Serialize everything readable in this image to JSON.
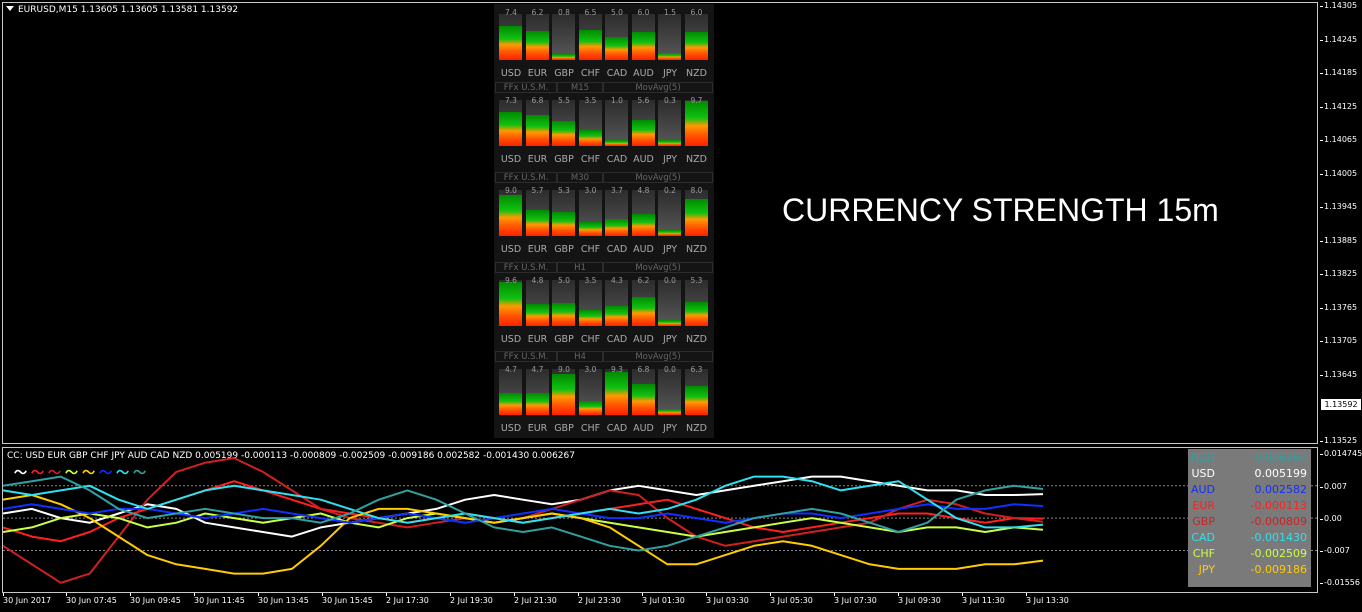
{
  "main_title": "EURUSD,M15  1.13605 1.13605 1.13581 1.13592",
  "big_label": "CURRENCY STRENGTH 15m",
  "current_price": "1.13592",
  "y_ticks": [
    "1.14305",
    "1.14245",
    "1.14185",
    "1.14125",
    "1.14065",
    "1.14005",
    "1.13945",
    "1.13885",
    "1.13825",
    "1.13765",
    "1.13705",
    "1.13645",
    "1.13525"
  ],
  "sub_ticks": [
    "0.014745",
    "0.007",
    "0.00",
    "-0.007",
    "-0.01556"
  ],
  "x_ticks": [
    "30 Jun 2017",
    "30 Jun 07:45",
    "30 Jun 09:45",
    "30 Jun 11:45",
    "30 Jun 13:45",
    "30 Jun 15:45",
    "2 Jul 17:30",
    "2 Jul 19:30",
    "2 Jul 21:30",
    "2 Jul 23:30",
    "3 Jul 01:30",
    "3 Jul 03:30",
    "3 Jul 05:30",
    "3 Jul 07:30",
    "3 Jul 09:30",
    "3 Jul 11:30",
    "3 Jul 13:30"
  ],
  "currencies": [
    "USD",
    "EUR",
    "GBP",
    "CHF",
    "CAD",
    "AUD",
    "JPY",
    "NZD"
  ],
  "panel": {
    "blocks": [
      {
        "header": null,
        "values": [
          "7.4",
          "6.2",
          "0.8",
          "6.5",
          "5.0",
          "6.0",
          "1.5",
          "6.0"
        ]
      },
      {
        "header": {
          "name": "FFx U.S.M.",
          "tf": "M15",
          "method": "MovAvg(5)"
        },
        "values": [
          "7.3",
          "6.8",
          "5.5",
          "3.5",
          "1.0",
          "5.6",
          "0.3",
          "9.7"
        ]
      },
      {
        "header": {
          "name": "FFx U.S.M.",
          "tf": "M30",
          "method": "MovAvg(5)"
        },
        "values": [
          "9.0",
          "5.7",
          "5.3",
          "3.0",
          "3.7",
          "4.8",
          "0.2",
          "8.0"
        ]
      },
      {
        "header": {
          "name": "FFx U.S.M.",
          "tf": "H1",
          "method": "MovAvg(5)"
        },
        "values": [
          "9.6",
          "4.8",
          "5.0",
          "3.5",
          "4.3",
          "6.2",
          "0.0",
          "5.3"
        ]
      },
      {
        "header": {
          "name": "FFx U.S.M.",
          "tf": "H4",
          "method": "MovAvg(5)"
        },
        "values": [
          "4.7",
          "4.7",
          "9.0",
          "3.0",
          "9.3",
          "6.8",
          "0.0",
          "6.3"
        ]
      }
    ]
  },
  "cc": {
    "title": "CC:  USD EUR GBP CHF JPY AUD CAD NZD 0.005199 -0.000113 -0.000809 -0.002509 -0.009186 0.002582 -0.001430 0.006267",
    "legend_colors": [
      "#ffffff",
      "#ff2020",
      "#d02020",
      "#ccff44",
      "#ffcc00",
      "#1030ff",
      "#30e0f0",
      "#30a0a0"
    ],
    "legend_glyph": "〜",
    "table": [
      {
        "code": "NZD",
        "value": "0.006267",
        "color": "#30a0a0"
      },
      {
        "code": "USD",
        "value": "0.005199",
        "color": "#ffffff"
      },
      {
        "code": "AUD",
        "value": "0.002582",
        "color": "#1030ff"
      },
      {
        "code": "EUR",
        "value": "-0.000113",
        "color": "#ff2020"
      },
      {
        "code": "GBP",
        "value": "-0.000809",
        "color": "#d02020"
      },
      {
        "code": "CAD",
        "value": "-0.001430",
        "color": "#30e0f0"
      },
      {
        "code": "CHF",
        "value": "-0.002509",
        "color": "#ccff44"
      },
      {
        "code": "JPY",
        "value": "-0.009186",
        "color": "#ffcc00"
      }
    ],
    "series": [
      {
        "code": "USD",
        "color": "#ffffff",
        "values": [
          0.001,
          0.002,
          0.0,
          -0.001,
          0.001,
          0.003,
          0.002,
          -0.001,
          -0.002,
          -0.003,
          -0.004,
          -0.002,
          -0.001,
          0.0,
          0.001,
          0.002,
          0.004,
          0.005,
          0.004,
          0.003,
          0.004,
          0.006,
          0.007,
          0.006,
          0.005,
          0.006,
          0.007,
          0.008,
          0.009,
          0.009,
          0.008,
          0.007,
          0.006,
          0.006,
          0.005,
          0.005,
          0.0052
        ]
      },
      {
        "code": "EUR",
        "color": "#ff2020",
        "values": [
          -0.002,
          -0.004,
          -0.005,
          -0.003,
          0.0,
          0.002,
          0.004,
          0.006,
          0.008,
          0.006,
          0.004,
          0.002,
          0.001,
          0.0,
          -0.001,
          0.0,
          0.001,
          0.0,
          -0.001,
          0.0,
          0.001,
          0.002,
          0.003,
          0.004,
          0.002,
          0.0,
          -0.002,
          -0.003,
          -0.002,
          -0.001,
          0.0,
          0.001,
          0.001,
          0.0,
          -0.001,
          0.0,
          -0.0001
        ]
      },
      {
        "code": "GBP",
        "color": "#d02020",
        "values": [
          -0.006,
          -0.01,
          -0.014,
          -0.012,
          -0.004,
          0.004,
          0.01,
          0.012,
          0.013,
          0.01,
          0.006,
          0.002,
          0.0,
          -0.001,
          -0.002,
          -0.001,
          0.0,
          -0.001,
          0.0,
          0.002,
          0.004,
          0.006,
          0.005,
          0.0,
          -0.004,
          -0.006,
          -0.005,
          -0.004,
          -0.003,
          -0.002,
          -0.001,
          0.002,
          0.004,
          0.003,
          0.001,
          0.0,
          -0.0008
        ]
      },
      {
        "code": "CHF",
        "color": "#ccff44",
        "values": [
          -0.003,
          -0.002,
          0.0,
          0.001,
          0.0,
          -0.002,
          -0.001,
          0.001,
          0.0,
          -0.001,
          0.0,
          0.001,
          -0.001,
          -0.002,
          0.0,
          0.001,
          0.0,
          -0.001,
          0.0,
          0.001,
          0.0,
          -0.001,
          -0.002,
          -0.003,
          -0.004,
          -0.003,
          -0.002,
          -0.001,
          0.0,
          -0.001,
          -0.002,
          -0.003,
          -0.002,
          -0.002,
          -0.003,
          -0.002,
          -0.0025
        ]
      },
      {
        "code": "JPY",
        "color": "#ffcc00",
        "values": [
          0.004,
          0.005,
          0.003,
          0.0,
          -0.004,
          -0.008,
          -0.01,
          -0.011,
          -0.012,
          -0.012,
          -0.011,
          -0.006,
          0.0,
          0.002,
          0.002,
          0.001,
          0.0,
          -0.001,
          0.0,
          0.001,
          0.0,
          -0.002,
          -0.006,
          -0.01,
          -0.01,
          -0.008,
          -0.006,
          -0.005,
          -0.006,
          -0.008,
          -0.01,
          -0.011,
          -0.011,
          -0.011,
          -0.01,
          -0.01,
          -0.0092
        ]
      },
      {
        "code": "AUD",
        "color": "#1030ff",
        "values": [
          0.002,
          0.003,
          0.002,
          0.001,
          0.002,
          0.002,
          0.001,
          0.0,
          0.001,
          0.002,
          0.001,
          0.0,
          -0.001,
          0.0,
          0.001,
          0.0,
          -0.001,
          0.0,
          0.001,
          0.002,
          0.001,
          0.0,
          0.0,
          0.001,
          0.0,
          -0.001,
          0.0,
          0.001,
          0.001,
          0.0,
          0.001,
          0.002,
          0.003,
          0.002,
          0.002,
          0.003,
          0.0026
        ]
      },
      {
        "code": "CAD",
        "color": "#30e0f0",
        "values": [
          0.006,
          0.005,
          0.006,
          0.007,
          0.004,
          0.002,
          0.004,
          0.006,
          0.007,
          0.006,
          0.005,
          0.004,
          0.002,
          0.0,
          -0.001,
          0.0,
          0.001,
          0.0,
          -0.001,
          0.0,
          0.001,
          0.002,
          0.001,
          0.002,
          0.004,
          0.007,
          0.009,
          0.009,
          0.008,
          0.006,
          0.007,
          0.008,
          0.004,
          0.0,
          -0.002,
          -0.002,
          -0.0014
        ]
      },
      {
        "code": "NZD",
        "color": "#30a0a0",
        "values": [
          0.007,
          0.008,
          0.009,
          0.006,
          0.002,
          0.0,
          0.001,
          0.002,
          0.001,
          0.0,
          0.0,
          -0.001,
          0.001,
          0.004,
          0.006,
          0.004,
          0.001,
          -0.002,
          -0.003,
          -0.002,
          -0.004,
          -0.006,
          -0.007,
          -0.006,
          -0.004,
          -0.002,
          0.0,
          0.001,
          0.002,
          0.001,
          -0.001,
          -0.003,
          -0.001,
          0.004,
          0.006,
          0.007,
          0.0063
        ]
      }
    ]
  }
}
